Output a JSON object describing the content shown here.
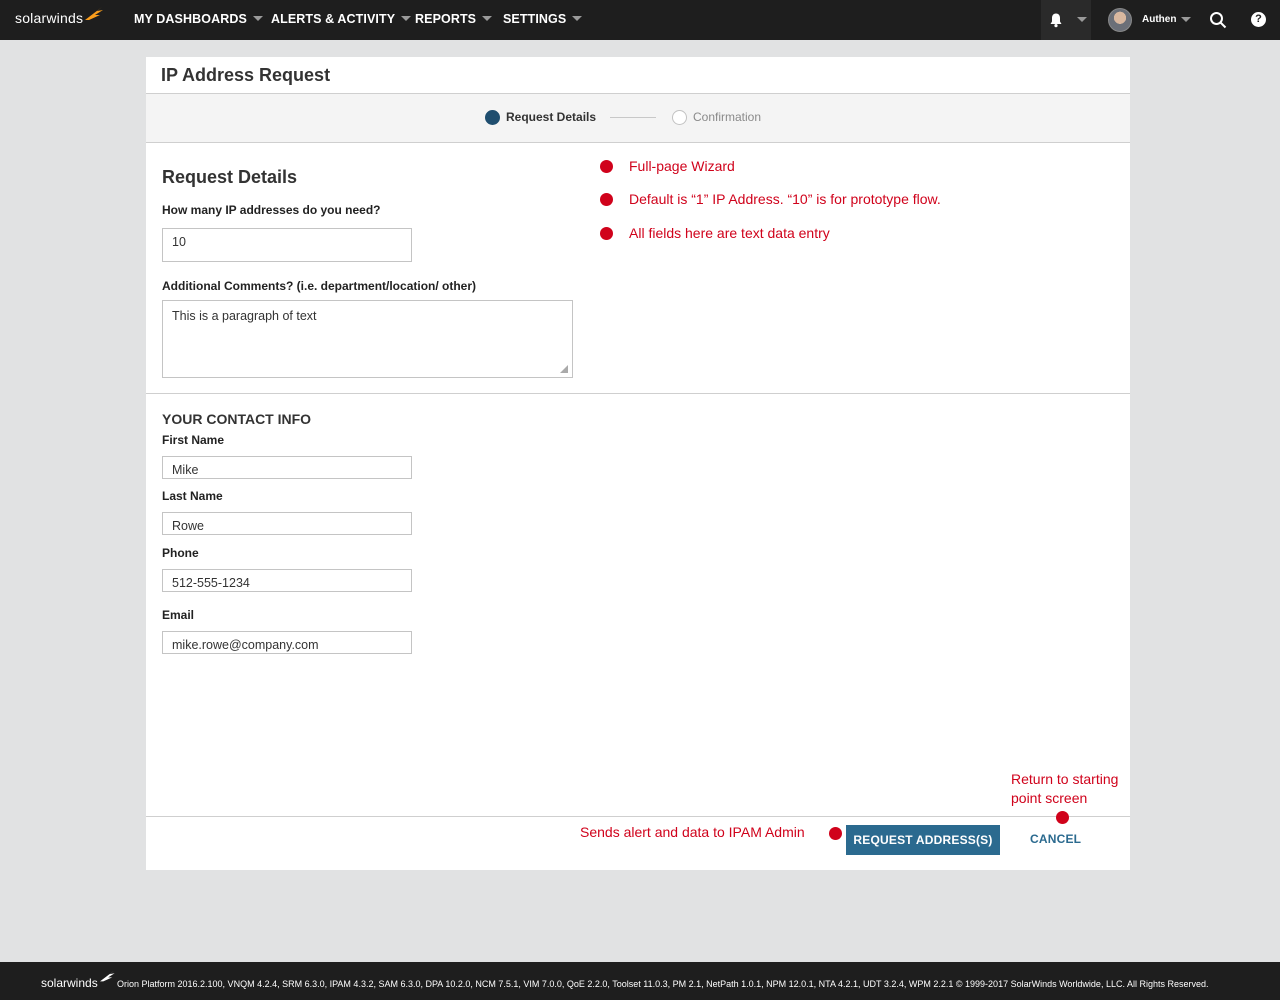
{
  "header": {
    "logo": "solarwinds",
    "nav": [
      {
        "label": "MY DASHBOARDS"
      },
      {
        "label": "ALERTS & ACTIVITY"
      },
      {
        "label": "REPORTS"
      },
      {
        "label": "SETTINGS"
      }
    ],
    "user_name": "Authen",
    "help_label": "?"
  },
  "page": {
    "title": "IP Address Request",
    "steps": [
      {
        "label": "Request Details",
        "state": "active"
      },
      {
        "label": "Confirmation",
        "state": "inactive"
      }
    ]
  },
  "request": {
    "title": "Request Details",
    "count_label": "How many IP addresses do you need?",
    "count_value": "10",
    "comments_label": "Additional Comments? (i.e. department/location/ other)",
    "comments_value": "This is a paragraph of text"
  },
  "contact": {
    "title": "YOUR CONTACT INFO",
    "first_name_label": "First Name",
    "first_name_value": "Mike",
    "last_name_label": "Last Name",
    "last_name_value": "Rowe",
    "phone_label": "Phone",
    "phone_value": "512-555-1234",
    "email_label": "Email",
    "email_value": "mike.rowe@company.com"
  },
  "actions": {
    "submit_label": "REQUEST ADDRESS(S)",
    "cancel_label": "CANCEL"
  },
  "annotations": {
    "notes": [
      "Full-page Wizard",
      "Default is “1” IP Address.  “10” is for prototype flow.",
      "All fields here are text data entry"
    ],
    "submit_note": "Sends alert and data to IPAM Admin",
    "cancel_note_line1": "Return to starting",
    "cancel_note_line2": "point screen",
    "color": "#d0021b"
  },
  "footer": {
    "logo": "solarwinds",
    "text": "Orion Platform 2016.2.100, VNQM 4.2.4, SRM 6.3.0, IPAM 4.3.2, SAM 6.3.0, DPA 10.2.0, NCM 7.5.1, VIM 7.0.0, QoE 2.2.0, Toolset 11.0.3, PM 2.1, NetPath 1.0.1, NPM 12.0.1, NTA 4.2.1, UDT 3.2.4, WPM 2.2.1 © 1999-2017 SolarWinds Worldwide, LLC. All Rights Reserved."
  },
  "colors": {
    "topbar": "#1e1e1e",
    "accent": "#2b6a8f",
    "step_active": "#1f4e6f",
    "logo_mark": "#f99d1c"
  }
}
